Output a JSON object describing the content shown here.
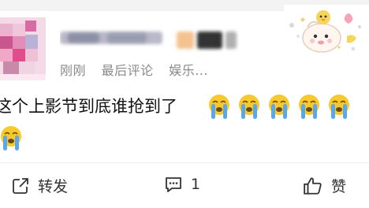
{
  "post": {
    "username_redacted": true,
    "meta": {
      "time": "刚刚",
      "source": "最后评论",
      "topic": "娱乐..."
    },
    "content": "这个上影节到底谁抢到了",
    "emoji_name": "crying-face-emoji",
    "emoji_count_line1": 5,
    "emoji_count_line2": 1
  },
  "actions": {
    "repost_label": "转发",
    "comment_count": "1",
    "like_label": "赞"
  },
  "colors": {
    "meta_text": "#8a8a8a",
    "emoji_face": "#f7c92d",
    "emoji_tear": "#5aa8e8"
  }
}
